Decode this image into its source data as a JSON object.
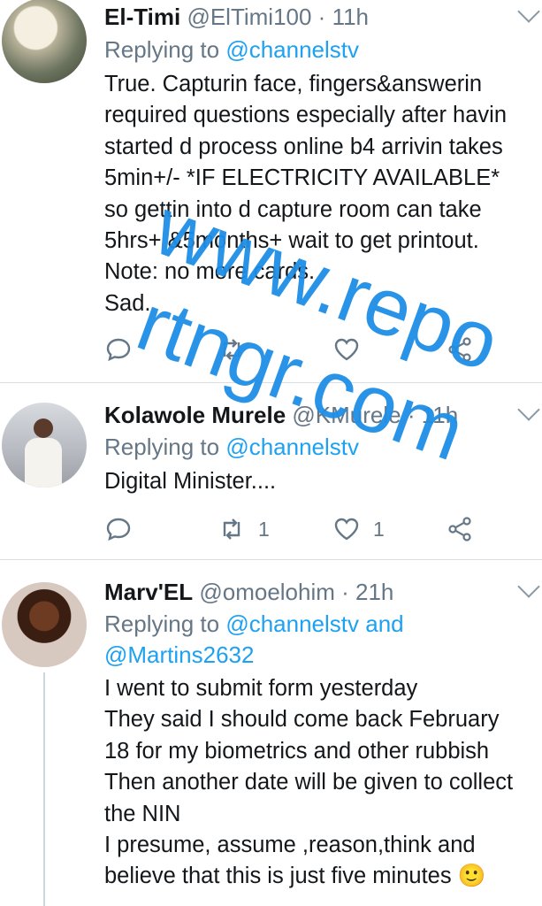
{
  "tweets": [
    {
      "name": "El-Timi",
      "handle": "@ElTimi100 · 11h",
      "replying_prefix": "Replying to",
      "replying_to": "@channelstv",
      "lines": [
        "True. Capturin face, fingers&answerin",
        "required questions especially after havin",
        "started d process online b4 arrivin takes",
        "5min+/- *IF ELECTRICITY AVAILABLE*",
        "so gettin into d capture room can take",
        "5hrs+ &5months+ wait to get printout.",
        "Note: no more cards.",
        "Sad."
      ],
      "actions": {
        "reply_icon": "reply-icon",
        "retweet_icon": "retweet-icon",
        "like_icon": "heart-icon",
        "share_icon": "share-icon"
      }
    },
    {
      "name": "Kolawole Murele",
      "handle": "@KMurele · 11h",
      "replying_prefix": "Replying to",
      "replying_to": "@channelstv",
      "lines": [
        "Digital Minister...."
      ],
      "actions": {
        "retweet_count": "1",
        "like_count": "1"
      }
    },
    {
      "name": "Marv'EL",
      "handle": "@omoelohim · 21h",
      "replying_prefix": "Replying to",
      "replying_to": "@channelstv and",
      "replying_to_2": "@Martins2632",
      "lines": [
        "I went to submit form yesterday",
        "They said I should come back February",
        "18 for my biometrics and other rubbish",
        "Then another date will be given to collect",
        "the NIN",
        "I presume, assume ,reason,think and",
        "believe that this is just five minutes 🙂"
      ]
    }
  ],
  "watermark": {
    "line1": "www.repo",
    "line2": "rtngr.com",
    "color": "#1e8fe6"
  }
}
